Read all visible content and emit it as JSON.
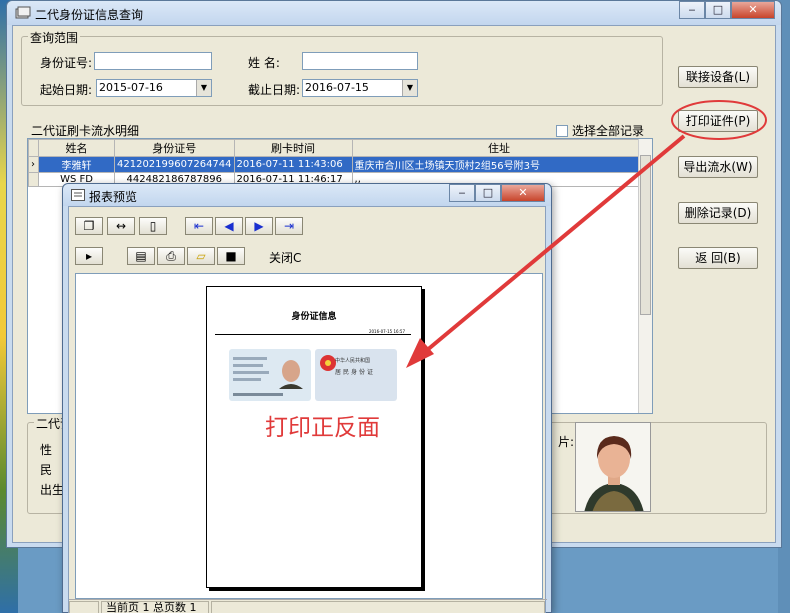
{
  "main_window": {
    "title": "二代身份证信息查询",
    "caption_min": "▭",
    "caption_max": "□",
    "caption_close": "✕"
  },
  "query": {
    "legend": "查询范围",
    "id_label": "身份证号:",
    "id_value": "",
    "name_label": "姓    名:",
    "name_value": "",
    "start_label": "起始日期:",
    "start_value": "2015-07-16",
    "end_label": "截止日期:",
    "end_value": "2016-07-15"
  },
  "side_buttons": {
    "connect": "联接设备(L)",
    "print": "打印证件(P)",
    "export": "导出流水(W)",
    "delete": "删除记录(D)",
    "back": "返 回(B)"
  },
  "records": {
    "title": "二代证刷卡流水明细",
    "select_all": "选择全部记录",
    "columns": [
      "姓名",
      "身份证号",
      "刷卡时间",
      "住址"
    ],
    "rows": [
      {
        "name": "李雅轩",
        "id": "421202199607264744",
        "time": "2016-07-11 11:43:06",
        "addr": "重庆市合川区土场镇天顶村2组56号附3号"
      },
      {
        "name": "WS FD",
        "id": "442482186787896",
        "time": "2016-07-11 11:46:17",
        "addr": ",,"
      }
    ]
  },
  "info": {
    "legend": "二代证日",
    "sex_label": "性",
    "nation_label": "民",
    "birth_label": "出生日",
    "right_label": "片:"
  },
  "preview": {
    "title": "报表预览",
    "close_label": "关闭C",
    "paper_title": "身份证信息",
    "paper_date": "2016-07-15 16:57",
    "id_back_line1": "中华人民共和国",
    "id_back_line2": "居民身份证",
    "status_page": "当前页 1 总页数 1"
  },
  "annotation": "打印正反面",
  "colors": {
    "selection": "#316ac5",
    "annotation": "#e03a3a",
    "window_frame": "#c9dbef"
  }
}
